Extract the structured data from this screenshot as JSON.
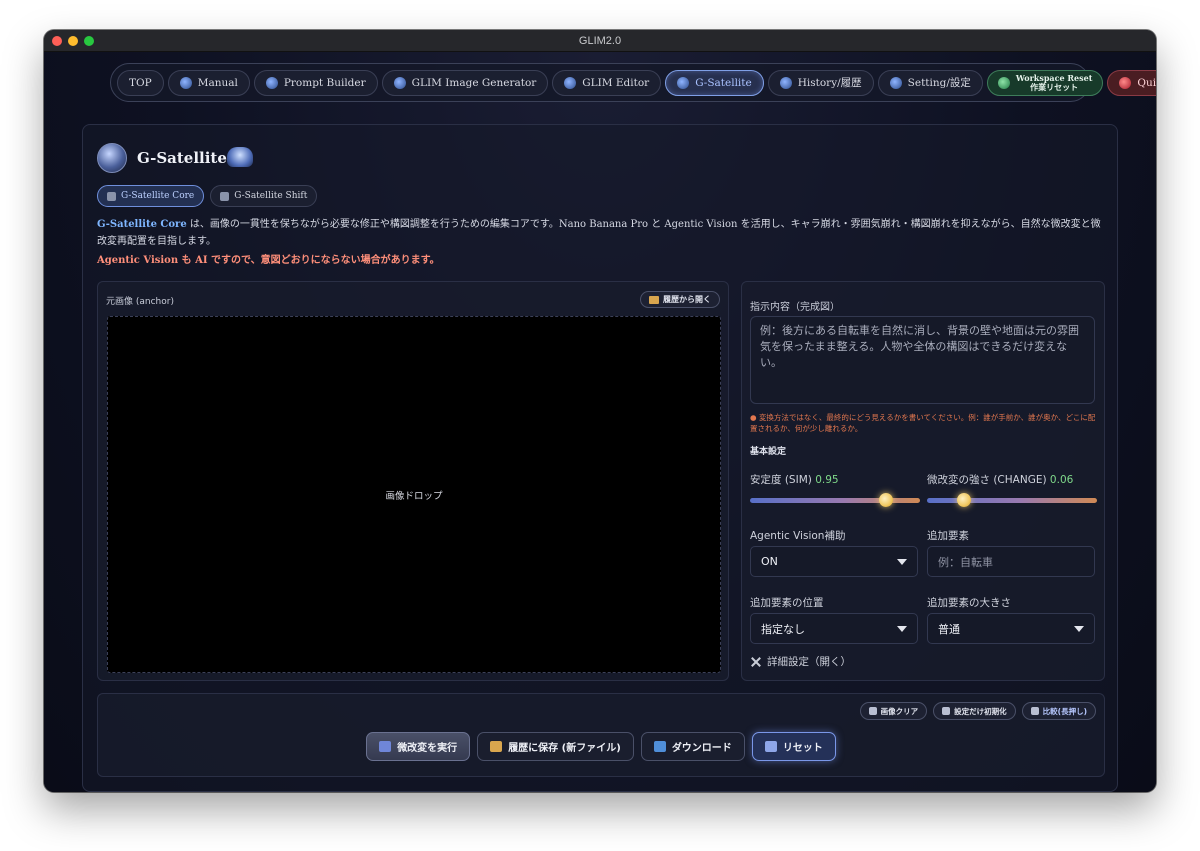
{
  "window": {
    "title": "GLIM2.0"
  },
  "nav": [
    {
      "label": "TOP",
      "icon": "none"
    },
    {
      "label": "Manual",
      "icon": "manual-icon"
    },
    {
      "label": "Prompt Builder",
      "icon": "prompt-builder-icon"
    },
    {
      "label": "GLIM Image Generator",
      "icon": "image-generator-icon"
    },
    {
      "label": "GLIM Editor",
      "icon": "editor-icon"
    },
    {
      "label": "G-Satellite",
      "icon": "satellite-icon",
      "active": true
    },
    {
      "label": "History/履歴",
      "icon": "history-icon"
    },
    {
      "label": "Setting/設定",
      "icon": "settings-icon"
    }
  ],
  "nav_reset": {
    "line1": "Workspace Reset",
    "line2": "作業リセット"
  },
  "nav_quit": {
    "label": "Quit/終了"
  },
  "page": {
    "title": "G-Satellite",
    "subtabs": [
      {
        "label": "G-Satellite Core",
        "active": true
      },
      {
        "label": "G-Satellite Shift",
        "active": false
      }
    ],
    "desc_highlight": "G-Satellite Core",
    "desc_rest": " は、画像の一貫性を保ちながら必要な修正や構図調整を行うための編集コアです。Nano Banana Pro と Agentic Vision を活用し、キャラ崩れ・雰囲気崩れ・構図崩れを抑えながら、自然な微改変と微改変再配置を目指します。",
    "warning": "Agentic Vision も AI ですので、意図どおりにならない場合があります。"
  },
  "left": {
    "label": "元画像 (anchor)",
    "history_button": "履歴から開く",
    "drop_text": "画像ドロップ"
  },
  "right": {
    "instruction_label": "指示内容（完成図）",
    "instruction_placeholder": "例：後方にある自転車を自然に消し、背景の壁や地面は元の雰囲気を保ったまま整える。人物や全体の構図はできるだけ変えない。",
    "hint": "変換方法ではなく、最終的にどう見えるかを書いてください。例：誰が手前か、誰が奥か、どこに配置されるか、何が少し離れるか。",
    "basic_settings": "基本設定",
    "sim_label": "安定度 (SIM)",
    "sim_value": "0.95",
    "change_label": "微改変の強さ (CHANGE)",
    "change_value": "0.06",
    "agentic_label": "Agentic Vision補助",
    "agentic_value": "ON",
    "add_element_label": "追加要素",
    "add_element_placeholder": "例：自転車",
    "position_label": "追加要素の位置",
    "position_value": "指定なし",
    "size_label": "追加要素の大きさ",
    "size_value": "普通",
    "details_label": "詳細設定（開く）"
  },
  "bottom": {
    "clear_image": "画像クリア",
    "reset_settings": "設定だけ初期化",
    "compare": "比較(長押し)",
    "run": "微改変を実行",
    "save": "履歴に保存 (新ファイル)",
    "download": "ダウンロード",
    "reset": "リセット"
  },
  "colors": {
    "accent": "#7fb6ff",
    "warning": "#ff8f7a",
    "value_green": "#7fd88a"
  }
}
